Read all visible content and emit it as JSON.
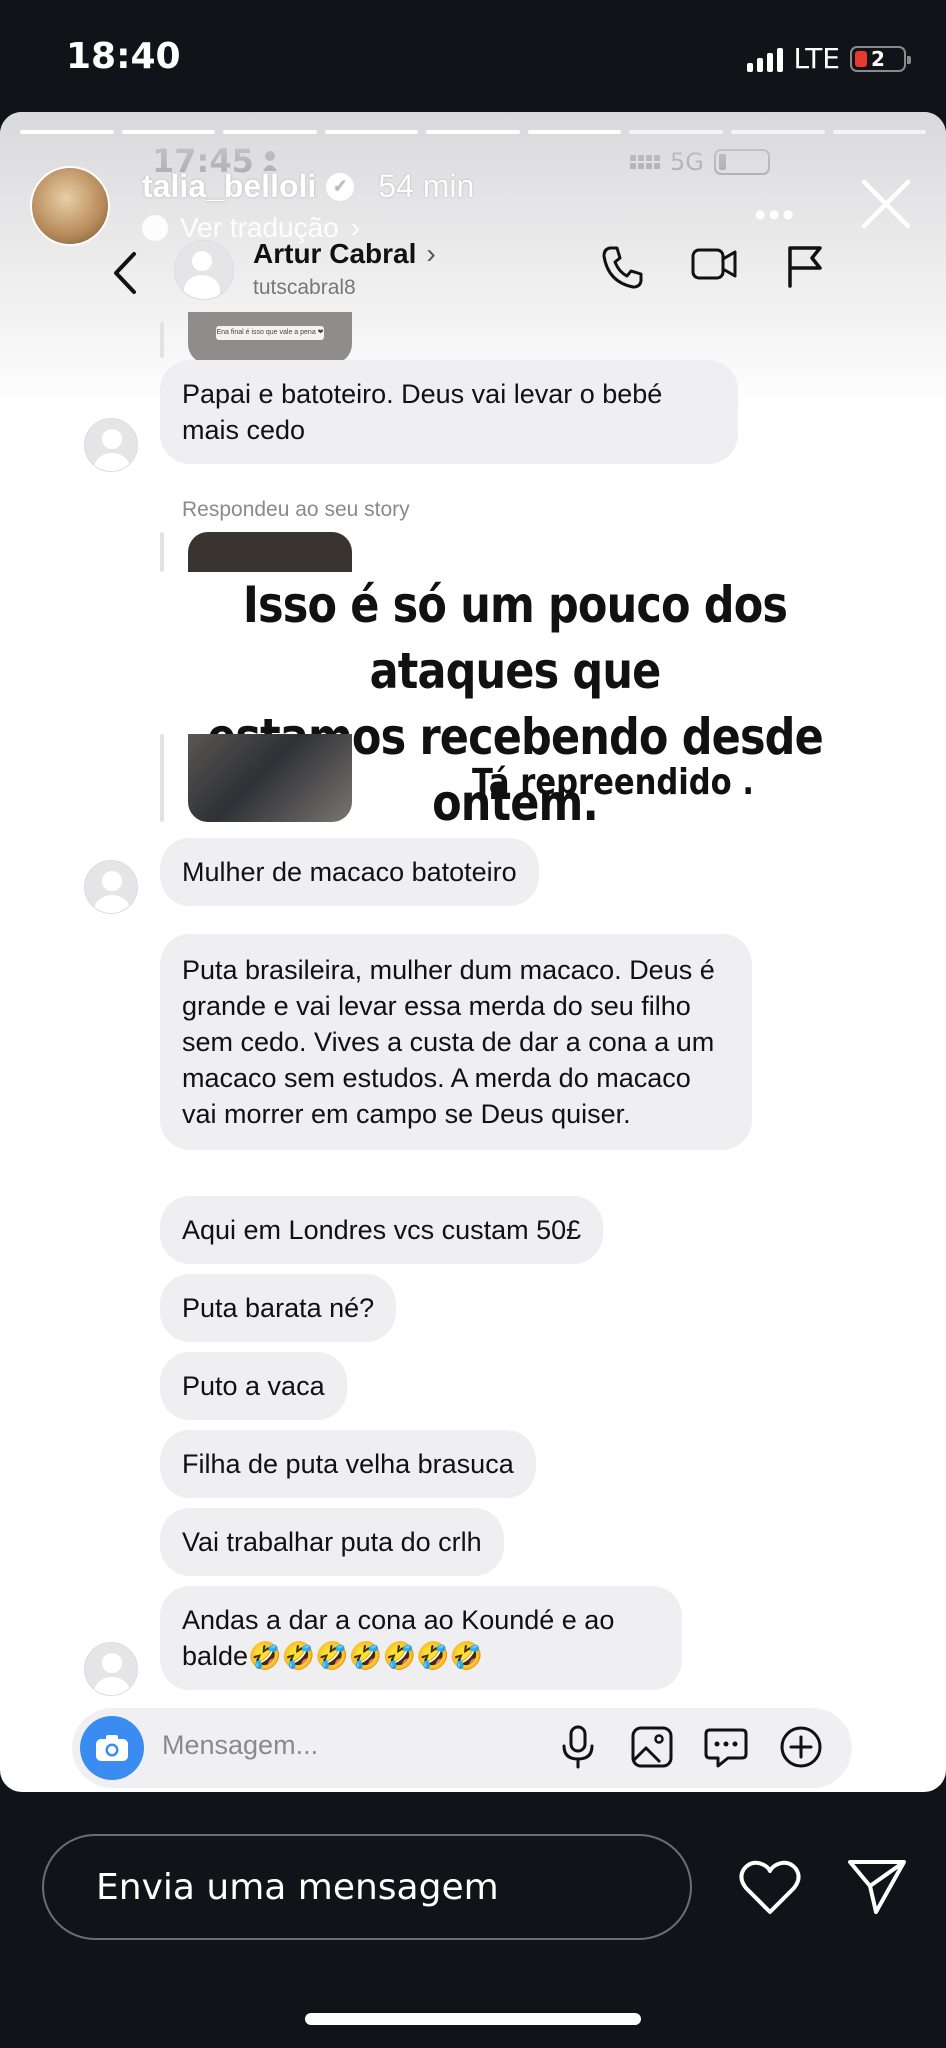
{
  "os_status": {
    "time": "18:40",
    "network": "LTE",
    "battery_label": "2"
  },
  "story": {
    "username": "talia_belloli",
    "time_ago": "54 min",
    "translate_label": "Ver tradução",
    "progress_segments_done": 6,
    "progress_segments_total": 9
  },
  "inner_status": {
    "time": "17:45",
    "network": "5G"
  },
  "dm_header": {
    "name": "Artur Cabral",
    "handle": "tutscabral8"
  },
  "messages": [
    "Papai e batoteiro. Deus vai levar o bebé mais cedo",
    "Mulher de macaco batoteiro",
    "Puta brasileira, mulher dum macaco. Deus é grande e vai levar essa merda do seu filho sem cedo. Vives a custa de dar a cona a um macaco sem estudos. A merda do macaco vai morrer em campo se Deus quiser.",
    "Aqui em Londres vcs custam 50£",
    "Puta barata né?",
    "Puto a vaca",
    "Filha de puta velha brasuca",
    "Vai trabalhar puta do crlh",
    "Andas a dar a cona ao Koundé e ao balde🤣🤣🤣🤣🤣🤣🤣"
  ],
  "replied_label": "Respondeu ao seu story",
  "thumb_caption": "Ena final é isso que vale a pena ❤",
  "overlay": {
    "line1": "Isso é só um pouco dos ataques que",
    "line2": "estamos recebendo desde ontem.",
    "sub": "Tá repreendido ."
  },
  "composer": {
    "placeholder": "Mensagem..."
  },
  "reply_bar": {
    "placeholder": "Envia uma mensagem"
  },
  "icons": {
    "back": "chevron-left-icon",
    "call": "phone-icon",
    "video": "video-icon",
    "flag": "flag-icon",
    "camera": "camera-icon",
    "mic": "microphone-icon",
    "gallery": "image-icon",
    "sticker": "sticker-icon",
    "plus": "plus-icon",
    "heart": "heart-icon",
    "send": "send-icon",
    "close": "close-icon",
    "more": "more-icon"
  }
}
